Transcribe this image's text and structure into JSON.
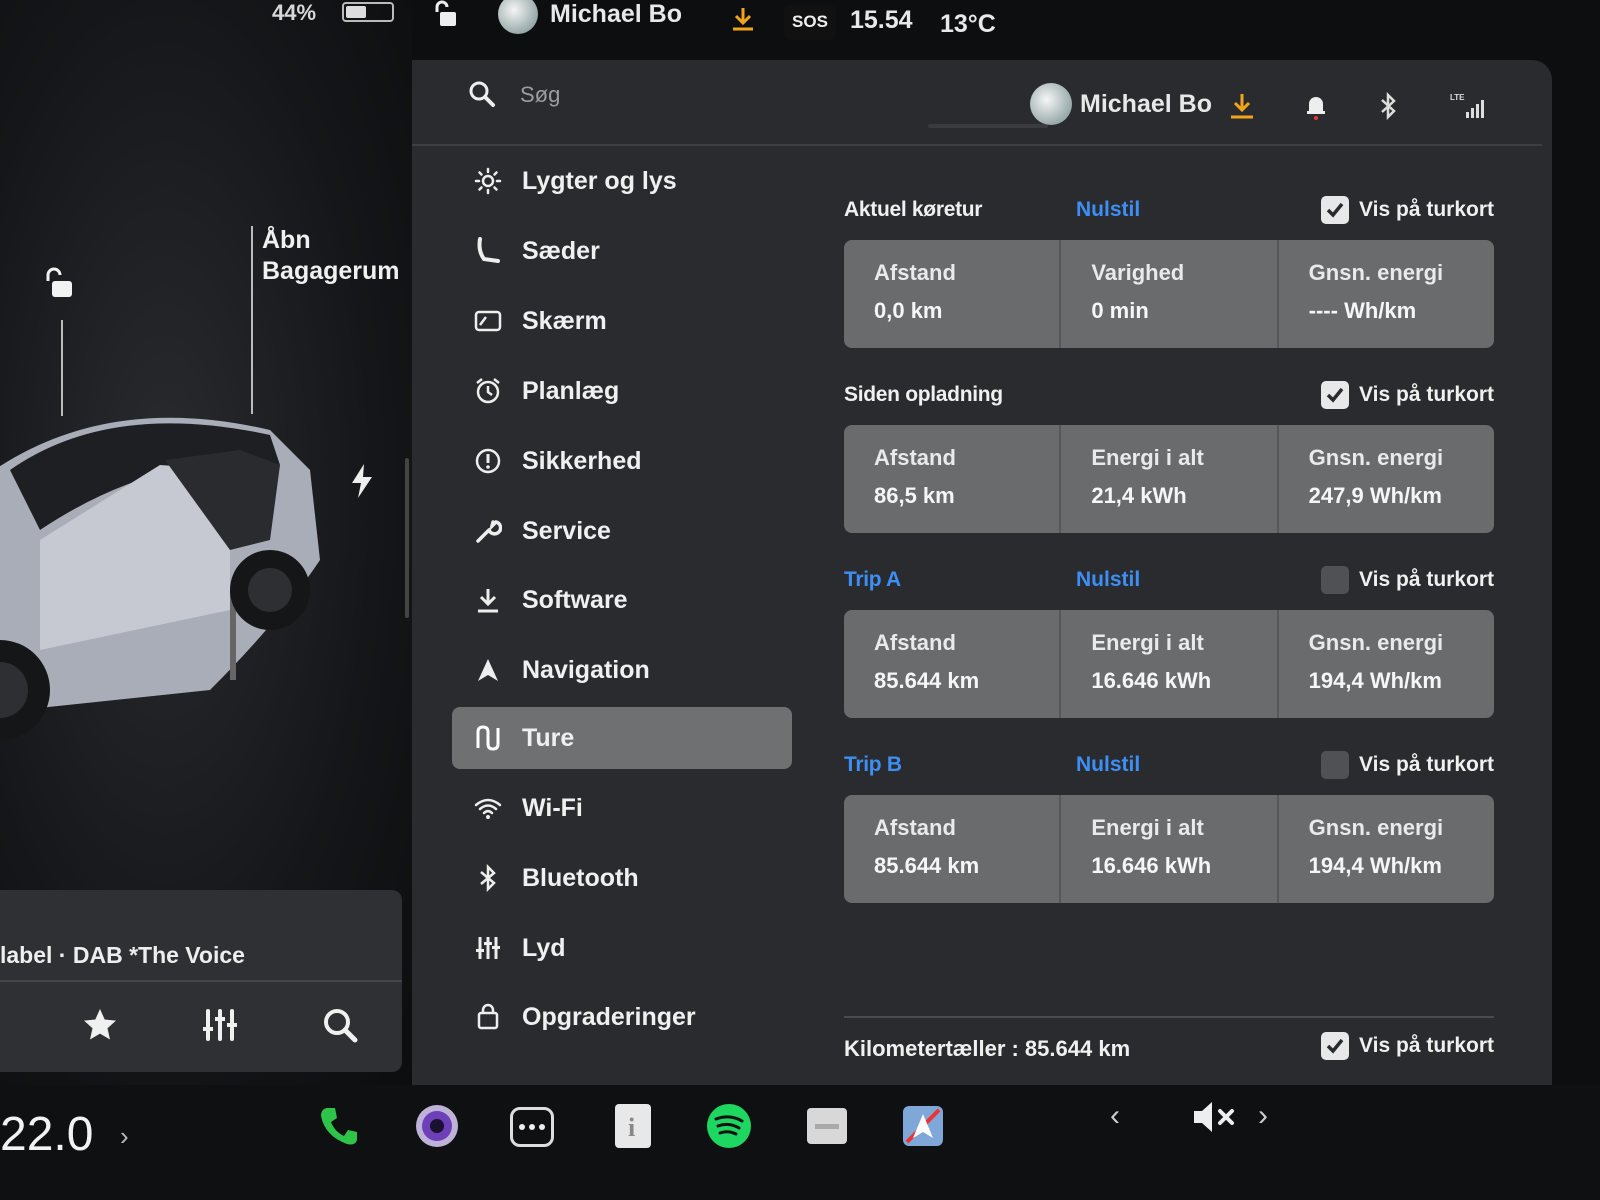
{
  "status": {
    "battery_pct": "44%",
    "user_name": "Michael Bo",
    "sos_label": "SOS",
    "time": "15.54",
    "temperature": "13°C"
  },
  "car": {
    "trunk_label_line1": "Åbn",
    "trunk_label_line2": "Bagagerum"
  },
  "media": {
    "now_playing": "label · DAB *The Voice",
    "buttons": [
      "star-icon",
      "equalizer-icon",
      "search-icon"
    ]
  },
  "header": {
    "search_placeholder": "Søg",
    "profile_name": "Michael Bo",
    "icons": [
      "download-icon",
      "bell-icon",
      "bluetooth-icon",
      "lte-signal-icon"
    ],
    "lte_label": "LTE"
  },
  "nav": {
    "items": [
      {
        "label": "Lygter og lys",
        "icon": "sun-icon"
      },
      {
        "label": "Sæder",
        "icon": "seat-icon"
      },
      {
        "label": "Skærm",
        "icon": "display-icon"
      },
      {
        "label": "Planlæg",
        "icon": "schedule-icon"
      },
      {
        "label": "Sikkerhed",
        "icon": "safety-icon"
      },
      {
        "label": "Service",
        "icon": "wrench-icon"
      },
      {
        "label": "Software",
        "icon": "download-icon"
      },
      {
        "label": "Navigation",
        "icon": "navigation-icon"
      },
      {
        "label": "Ture",
        "icon": "trips-icon",
        "active": true
      },
      {
        "label": "Wi-Fi",
        "icon": "wifi-icon"
      },
      {
        "label": "Bluetooth",
        "icon": "bluetooth-icon"
      },
      {
        "label": "Lyd",
        "icon": "sliders-icon"
      },
      {
        "label": "Opgraderinger",
        "icon": "bag-icon"
      }
    ]
  },
  "trips": {
    "map_label": "Vis på turkort",
    "reset_label": "Nulstil",
    "sections": [
      {
        "title": "Aktuel køretur",
        "blue": false,
        "reset": true,
        "on_map": true,
        "cells": [
          {
            "k": "Afstand",
            "v": "0,0 km"
          },
          {
            "k": "Varighed",
            "v": "0 min"
          },
          {
            "k": "Gnsn. energi",
            "v": "---- Wh/km"
          }
        ]
      },
      {
        "title": "Siden opladning",
        "blue": false,
        "reset": false,
        "on_map": true,
        "cells": [
          {
            "k": "Afstand",
            "v": "86,5 km"
          },
          {
            "k": "Energi i alt",
            "v": "21,4 kWh"
          },
          {
            "k": "Gnsn. energi",
            "v": "247,9 Wh/km"
          }
        ]
      },
      {
        "title": "Trip A",
        "blue": true,
        "reset": true,
        "on_map": false,
        "cells": [
          {
            "k": "Afstand",
            "v": "85.644 km"
          },
          {
            "k": "Energi i alt",
            "v": "16.646 kWh"
          },
          {
            "k": "Gnsn. energi",
            "v": "194,4 Wh/km"
          }
        ]
      },
      {
        "title": "Trip B",
        "blue": true,
        "reset": true,
        "on_map": false,
        "cells": [
          {
            "k": "Afstand",
            "v": "85.644 km"
          },
          {
            "k": "Energi i alt",
            "v": "16.646 kWh"
          },
          {
            "k": "Gnsn. energi",
            "v": "194,4 Wh/km"
          }
        ]
      }
    ],
    "odometer_label": "Kilometertæller : 85.644 km",
    "odometer_on_map": true
  },
  "dock": {
    "cabin_temp": "22.0",
    "apps": [
      "phone-icon",
      "camera-icon",
      "more-icon",
      "manual-icon",
      "spotify-icon",
      "calendar-icon",
      "navigation-app-icon"
    ]
  },
  "colors": {
    "accent_blue": "#3d8ff5",
    "download_orange": "#f2a51a",
    "spotify_green": "#1ed760",
    "phone_green": "#2ec44a",
    "panel_bg": "#2a2b2e",
    "card_bg": "#6a6b6d"
  }
}
